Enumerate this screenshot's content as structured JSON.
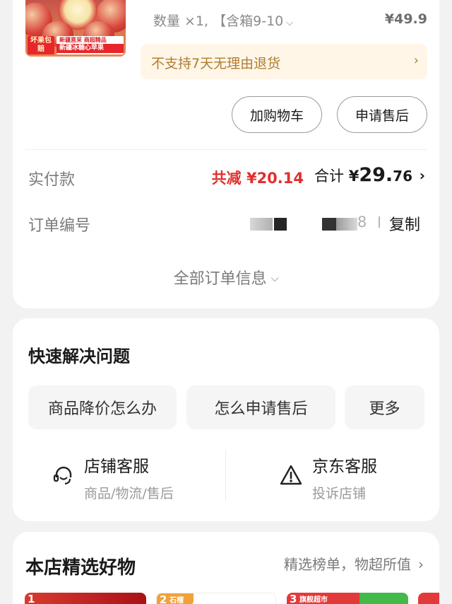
{
  "product": {
    "tag_left": "坏果包赔",
    "tag_right_top": "新疆直采  商超精品",
    "tag_right_bottom": "新疆冰糖心苹果",
    "qty_text": "数量 ×1, 【含箱9-10",
    "price": "¥49.9",
    "return_notice": "不支持7天无理由退货"
  },
  "actions": {
    "add_cart": "加购物车",
    "after_sale": "申请售后"
  },
  "payment": {
    "label": "实付款",
    "discount": "共减 ¥20.14",
    "total_prefix": "合计 ",
    "total_currency": "¥",
    "total_int": "29.",
    "total_dec": "76"
  },
  "order": {
    "label": "订单编号",
    "number_tail": "8",
    "copy": "复制"
  },
  "all_info": "全部订单信息",
  "quick_help": {
    "title": "快速解决问题",
    "chips": [
      "商品降价怎么办",
      "怎么申请售后",
      "更多"
    ],
    "services": [
      {
        "title": "店铺客服",
        "sub": "商品/物流/售后",
        "icon": "headset-icon"
      },
      {
        "title": "京东客服",
        "sub": "投诉店铺",
        "icon": "warning-icon"
      }
    ]
  },
  "recs": {
    "title": "本店精选好物",
    "subtitle": "精选榜单，物超所值",
    "items": [
      {
        "rank": "1",
        "label": ""
      },
      {
        "rank": "2",
        "label": "石榴"
      },
      {
        "rank": "3",
        "label": "旗舰超市"
      }
    ]
  },
  "colors": {
    "accent_red": "#e0302e",
    "notice_bg": "#fff6e8",
    "notice_text": "#b07c2d",
    "page_bg": "#f2f2f2"
  }
}
